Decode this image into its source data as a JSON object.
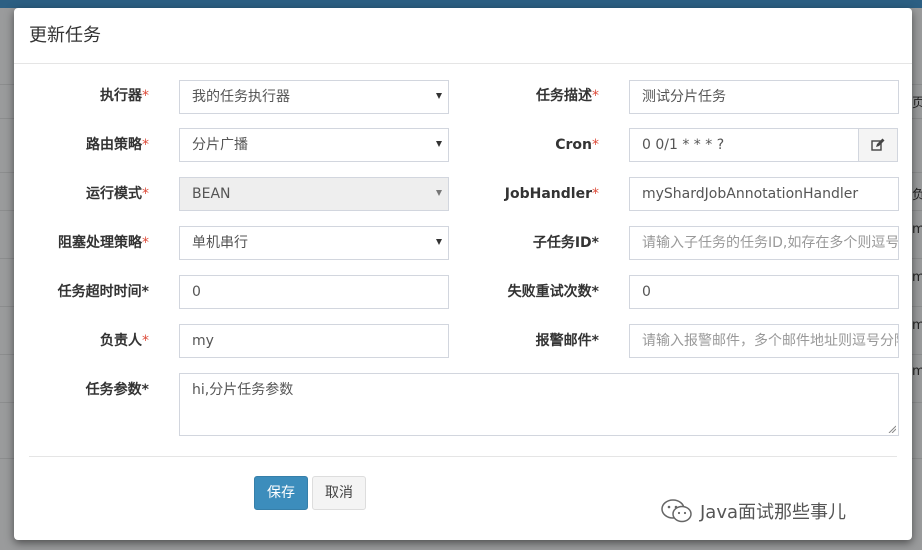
{
  "modal": {
    "title": "更新任务"
  },
  "labels": {
    "executor": "执行器",
    "task_desc": "任务描述",
    "route_strategy": "路由策略",
    "cron": "Cron",
    "run_mode": "运行模式",
    "job_handler": "JobHandler",
    "block_strategy": "阻塞处理策略",
    "child_job_id": "子任务ID",
    "timeout": "任务超时时间",
    "fail_retry": "失败重试次数",
    "owner": "负责人",
    "alarm_email": "报警邮件",
    "task_param": "任务参数",
    "required_mark": "*"
  },
  "fields": {
    "executor_value": "我的任务执行器",
    "task_desc_value": "测试分片任务",
    "route_strategy_value": "分片广播",
    "cron_value": "0 0/1 * * * ?",
    "run_mode_value": "BEAN",
    "job_handler_value": "myShardJobAnnotationHandler",
    "block_strategy_value": "单机串行",
    "child_job_id_placeholder": "请输入子任务的任务ID,如存在多个则逗号分隔",
    "timeout_value": "0",
    "fail_retry_value": "0",
    "owner_value": "my",
    "alarm_email_placeholder": "请输入报警邮件，多个邮件地址则逗号分隔",
    "task_param_value": "hi,分片任务参数"
  },
  "buttons": {
    "save": "保存",
    "cancel": "取消"
  },
  "watermark": {
    "text": "Java面试那些事儿"
  },
  "background": {
    "right_edge_texts": [
      "页",
      "负",
      "m",
      "m",
      "m",
      "m"
    ]
  },
  "colors": {
    "primary": "#3c8dbc",
    "required": "#dd4b39",
    "topbar": "#2c5f83"
  },
  "icons": {
    "cron_edit": "edit-icon",
    "watermark_logo": "wechat-logo-icon"
  }
}
